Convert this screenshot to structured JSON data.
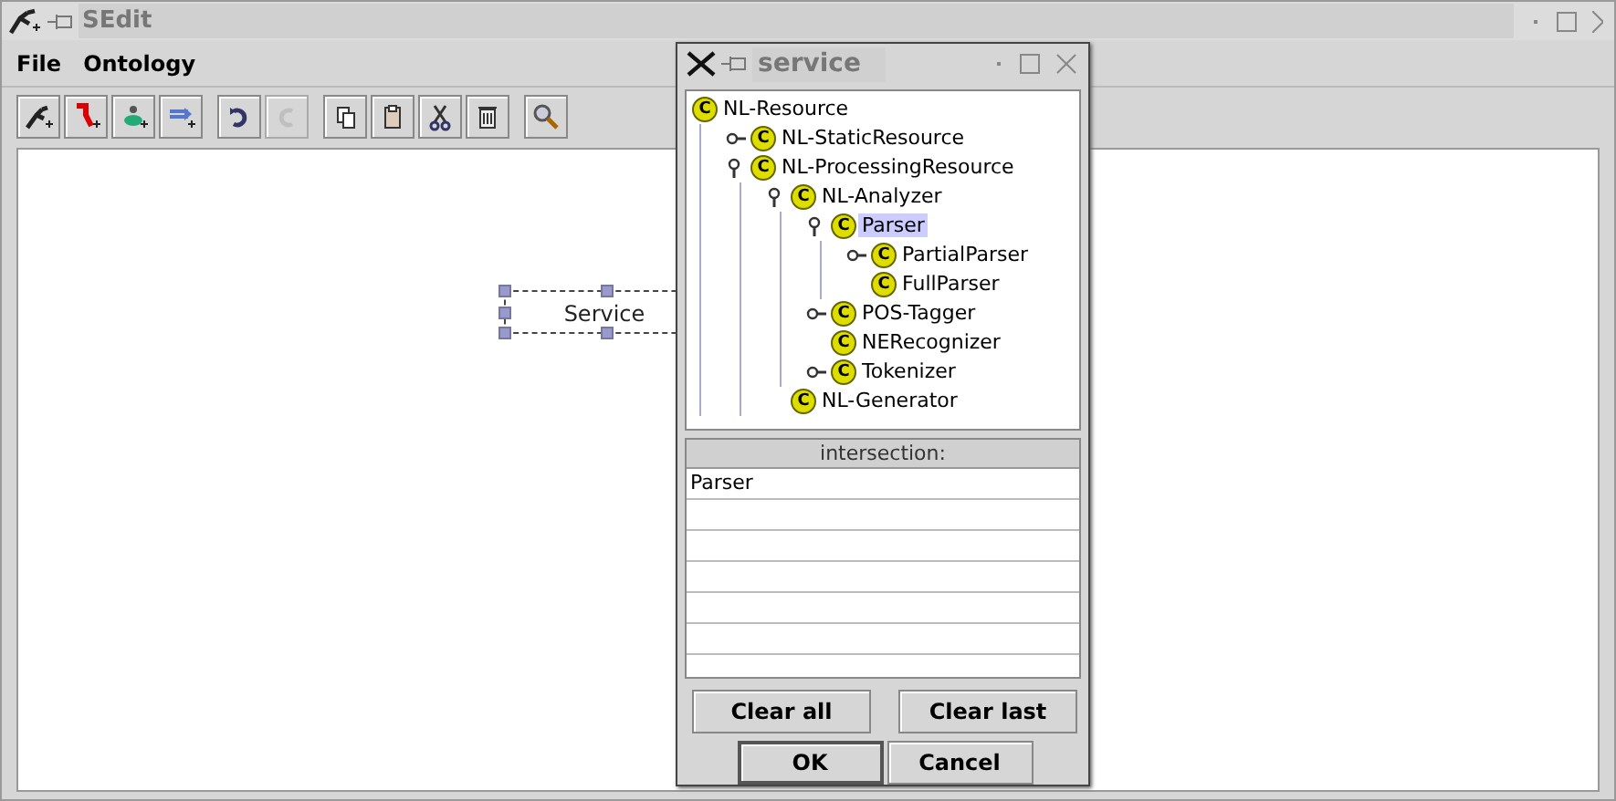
{
  "window": {
    "title": "SEdit"
  },
  "menu": [
    "File",
    "Ontology"
  ],
  "toolbar": [
    [
      {
        "disabled": false
      },
      {
        "disabled": false
      },
      {
        "disabled": false
      },
      {
        "disabled": false
      }
    ],
    [
      {
        "disabled": false
      },
      {
        "disabled": true
      }
    ],
    [
      {
        "disabled": false
      },
      {
        "disabled": false
      },
      {
        "disabled": false
      },
      {
        "disabled": false
      }
    ],
    [
      {
        "disabled": false
      }
    ]
  ],
  "canvas": {
    "nodes": [
      {
        "label": "Service",
        "selected": true
      }
    ]
  },
  "dialog": {
    "title": "service",
    "tree": [
      {
        "badge": "C",
        "label": "NL-Resource",
        "kind": "root",
        "selected": false,
        "children": [
          {
            "badge": "C",
            "label": "NL-StaticResource",
            "kind": "branch",
            "expanded": false,
            "selected": false
          },
          {
            "badge": "C",
            "label": "NL-ProcessingResource",
            "kind": "branch",
            "expanded": true,
            "selected": false,
            "children": [
              {
                "badge": "C",
                "label": "NL-Analyzer",
                "kind": "branch",
                "expanded": true,
                "selected": false,
                "children": [
                  {
                    "badge": "C",
                    "label": "Parser",
                    "kind": "branch",
                    "expanded": true,
                    "selected": true,
                    "children": [
                      {
                        "badge": "C",
                        "label": "PartialParser",
                        "kind": "branch",
                        "expanded": false,
                        "selected": false
                      },
                      {
                        "badge": "C",
                        "label": "FullParser",
                        "kind": "leaf",
                        "selected": false
                      }
                    ]
                  },
                  {
                    "badge": "C",
                    "label": "POS-Tagger",
                    "kind": "branch",
                    "expanded": false,
                    "selected": false
                  },
                  {
                    "badge": "C",
                    "label": "NERecognizer",
                    "kind": "leaf",
                    "selected": false
                  },
                  {
                    "badge": "C",
                    "label": "Tokenizer",
                    "kind": "branch",
                    "expanded": false,
                    "selected": false
                  }
                ]
              },
              {
                "badge": "C",
                "label": "NL-Generator",
                "kind": "leaf",
                "selected": false
              }
            ]
          }
        ]
      }
    ],
    "table": {
      "columns": [
        "intersection:"
      ],
      "rows": [
        "Parser"
      ]
    },
    "buttons": [
      [
        "Clear all",
        "Clear last"
      ],
      [
        "OK",
        "Cancel"
      ]
    ]
  }
}
